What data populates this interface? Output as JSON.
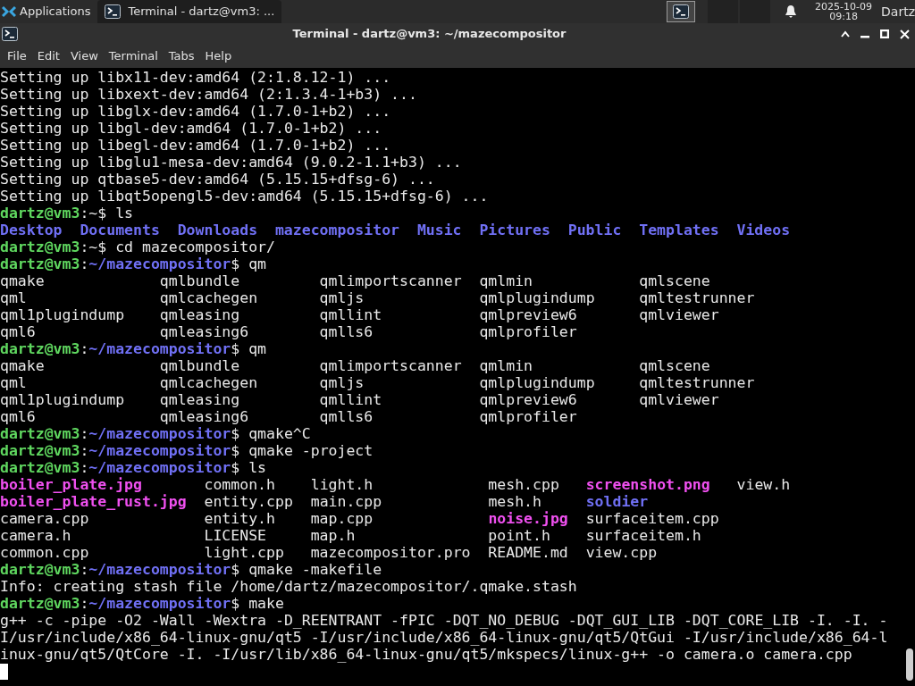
{
  "panel": {
    "apps_label": "Applications",
    "task": {
      "title": "Terminal - dartz@vm3: ...",
      "selected": true
    },
    "date": "2025-10-09",
    "time": "09:18",
    "user": "Dartz"
  },
  "window": {
    "title": "Terminal - dartz@vm3: ~/mazecompositor"
  },
  "menu": [
    "File",
    "Edit",
    "View",
    "Terminal",
    "Tabs",
    "Help"
  ],
  "terminal": {
    "lines": [
      {
        "kind": "text",
        "segments": [
          {
            "text": "Setting up libx11-dev:amd64 (2:1.8.12-1) ...",
            "kind": "plain"
          }
        ]
      },
      {
        "kind": "text",
        "segments": [
          {
            "text": "Setting up libxext-dev:amd64 (2:1.3.4-1+b3) ...",
            "kind": "plain"
          }
        ]
      },
      {
        "kind": "text",
        "segments": [
          {
            "text": "Setting up libglx-dev:amd64 (1.7.0-1+b2) ...",
            "kind": "plain"
          }
        ]
      },
      {
        "kind": "text",
        "segments": [
          {
            "text": "Setting up libgl-dev:amd64 (1.7.0-1+b2) ...",
            "kind": "plain"
          }
        ]
      },
      {
        "kind": "text",
        "segments": [
          {
            "text": "Setting up libegl-dev:amd64 (1.7.0-1+b2) ...",
            "kind": "plain"
          }
        ]
      },
      {
        "kind": "text",
        "segments": [
          {
            "text": "Setting up libglu1-mesa-dev:amd64 (9.0.2-1.1+b3) ...",
            "kind": "plain"
          }
        ]
      },
      {
        "kind": "text",
        "segments": [
          {
            "text": "Setting up qtbase5-dev:amd64 (5.15.15+dfsg-6) ...",
            "kind": "plain"
          }
        ]
      },
      {
        "kind": "text",
        "segments": [
          {
            "text": "Setting up libqt5opengl5-dev:amd64 (5.15.15+dfsg-6) ...",
            "kind": "plain"
          }
        ]
      },
      {
        "kind": "text",
        "segments": [
          {
            "text": "dartz@vm3",
            "kind": "user"
          },
          {
            "text": ":~$ ls",
            "kind": "plain"
          }
        ]
      },
      {
        "kind": "list",
        "segments": [
          {
            "text": "Desktop",
            "kind": "dir"
          },
          {
            "text": "Documents",
            "kind": "dir"
          },
          {
            "text": "Downloads",
            "kind": "dir"
          },
          {
            "text": "mazecompositor",
            "kind": "dir"
          },
          {
            "text": "Music",
            "kind": "dir"
          },
          {
            "text": "Pictures",
            "kind": "dir"
          },
          {
            "text": "Public",
            "kind": "dir"
          },
          {
            "text": "Templates",
            "kind": "dir"
          },
          {
            "text": "Videos",
            "kind": "dir"
          }
        ]
      },
      {
        "kind": "text",
        "segments": [
          {
            "text": "dartz@vm3",
            "kind": "user"
          },
          {
            "text": ":~$ cd mazecompositor/",
            "kind": "plain"
          }
        ]
      },
      {
        "kind": "text",
        "segments": [
          {
            "text": "dartz@vm3",
            "kind": "user"
          },
          {
            "text": ":",
            "kind": "plain"
          },
          {
            "text": "~/mazecompositor",
            "kind": "dir"
          },
          {
            "text": "$ qm",
            "kind": "plain"
          }
        ]
      },
      {
        "kind": "text",
        "segments": [
          {
            "text": "qmake             qmlbundle         qmlimportscanner  qmlmin            qmlscene",
            "kind": "plain"
          }
        ]
      },
      {
        "kind": "text",
        "segments": [
          {
            "text": "qml               qmlcachegen       qmljs             qmlplugindump     qmltestrunner",
            "kind": "plain"
          }
        ]
      },
      {
        "kind": "text",
        "segments": [
          {
            "text": "qml1plugindump    qmleasing         qmllint           qmlpreview6       qmlviewer",
            "kind": "plain"
          }
        ]
      },
      {
        "kind": "text",
        "segments": [
          {
            "text": "qml6              qmleasing6        qmlls6            qmlprofiler",
            "kind": "plain"
          }
        ]
      },
      {
        "kind": "text",
        "segments": [
          {
            "text": "dartz@vm3",
            "kind": "user"
          },
          {
            "text": ":",
            "kind": "plain"
          },
          {
            "text": "~/mazecompositor",
            "kind": "dir"
          },
          {
            "text": "$ qm",
            "kind": "plain"
          }
        ]
      },
      {
        "kind": "text",
        "segments": [
          {
            "text": "qmake             qmlbundle         qmlimportscanner  qmlmin            qmlscene",
            "kind": "plain"
          }
        ]
      },
      {
        "kind": "text",
        "segments": [
          {
            "text": "qml               qmlcachegen       qmljs             qmlplugindump     qmltestrunner",
            "kind": "plain"
          }
        ]
      },
      {
        "kind": "text",
        "segments": [
          {
            "text": "qml1plugindump    qmleasing         qmllint           qmlpreview6       qmlviewer",
            "kind": "plain"
          }
        ]
      },
      {
        "kind": "text",
        "segments": [
          {
            "text": "qml6              qmleasing6        qmlls6            qmlprofiler",
            "kind": "plain"
          }
        ]
      },
      {
        "kind": "text",
        "segments": [
          {
            "text": "dartz@vm3",
            "kind": "user"
          },
          {
            "text": ":",
            "kind": "plain"
          },
          {
            "text": "~/mazecompositor",
            "kind": "dir"
          },
          {
            "text": "$ qmake^C",
            "kind": "plain"
          }
        ]
      },
      {
        "kind": "text",
        "segments": [
          {
            "text": "dartz@vm3",
            "kind": "user"
          },
          {
            "text": ":",
            "kind": "plain"
          },
          {
            "text": "~/mazecompositor",
            "kind": "dir"
          },
          {
            "text": "$ qmake -project",
            "kind": "plain"
          }
        ]
      },
      {
        "kind": "text",
        "segments": [
          {
            "text": "dartz@vm3",
            "kind": "user"
          },
          {
            "text": ":",
            "kind": "plain"
          },
          {
            "text": "~/mazecompositor",
            "kind": "dir"
          },
          {
            "text": "$ ls",
            "kind": "plain"
          }
        ]
      },
      {
        "kind": "text",
        "segments": [
          {
            "text": "boiler_plate.jpg",
            "kind": "image"
          },
          {
            "text": "       common.h    light.h             mesh.cpp   ",
            "kind": "plain"
          },
          {
            "text": "screenshot.png",
            "kind": "image"
          },
          {
            "text": "   view.h",
            "kind": "plain"
          }
        ]
      },
      {
        "kind": "text",
        "segments": [
          {
            "text": "boiler_plate_rust.jpg",
            "kind": "image"
          },
          {
            "text": "  entity.cpp  main.cpp            mesh.h     ",
            "kind": "plain"
          },
          {
            "text": "soldier",
            "kind": "dir"
          }
        ]
      },
      {
        "kind": "text",
        "segments": [
          {
            "text": "camera.cpp             entity.h    map.cpp             ",
            "kind": "plain"
          },
          {
            "text": "noise.jpg",
            "kind": "image"
          },
          {
            "text": "  surfaceitem.cpp",
            "kind": "plain"
          }
        ]
      },
      {
        "kind": "text",
        "segments": [
          {
            "text": "camera.h               LICENSE     map.h               point.h    surfaceitem.h",
            "kind": "plain"
          }
        ]
      },
      {
        "kind": "text",
        "segments": [
          {
            "text": "common.cpp             light.cpp   mazecompositor.pro  README.md  view.cpp",
            "kind": "plain"
          }
        ]
      },
      {
        "kind": "text",
        "segments": [
          {
            "text": "dartz@vm3",
            "kind": "user"
          },
          {
            "text": ":",
            "kind": "plain"
          },
          {
            "text": "~/mazecompositor",
            "kind": "dir"
          },
          {
            "text": "$ qmake -makefile",
            "kind": "plain"
          }
        ]
      },
      {
        "kind": "text",
        "segments": [
          {
            "text": "Info: creating stash file /home/dartz/mazecompositor/.qmake.stash",
            "kind": "plain"
          }
        ]
      },
      {
        "kind": "text",
        "segments": [
          {
            "text": "dartz@vm3",
            "kind": "user"
          },
          {
            "text": ":",
            "kind": "plain"
          },
          {
            "text": "~/mazecompositor",
            "kind": "dir"
          },
          {
            "text": "$ make",
            "kind": "plain"
          }
        ]
      },
      {
        "kind": "text",
        "segments": [
          {
            "text": "g++ -c -pipe -O2 -Wall -Wextra -D_REENTRANT -fPIC -DQT_NO_DEBUG -DQT_GUI_LIB -DQT_CORE_LIB -I. -I. -",
            "kind": "plain"
          }
        ]
      },
      {
        "kind": "text",
        "segments": [
          {
            "text": "I/usr/include/x86_64-linux-gnu/qt5 -I/usr/include/x86_64-linux-gnu/qt5/QtGui -I/usr/include/x86_64-l",
            "kind": "plain"
          }
        ]
      },
      {
        "kind": "text",
        "segments": [
          {
            "text": "inux-gnu/qt5/QtCore -I. -I/usr/lib/x86_64-linux-gnu/qt5/mkspecs/linux-g++ -o camera.o camera.cpp",
            "kind": "plain"
          }
        ]
      }
    ]
  }
}
